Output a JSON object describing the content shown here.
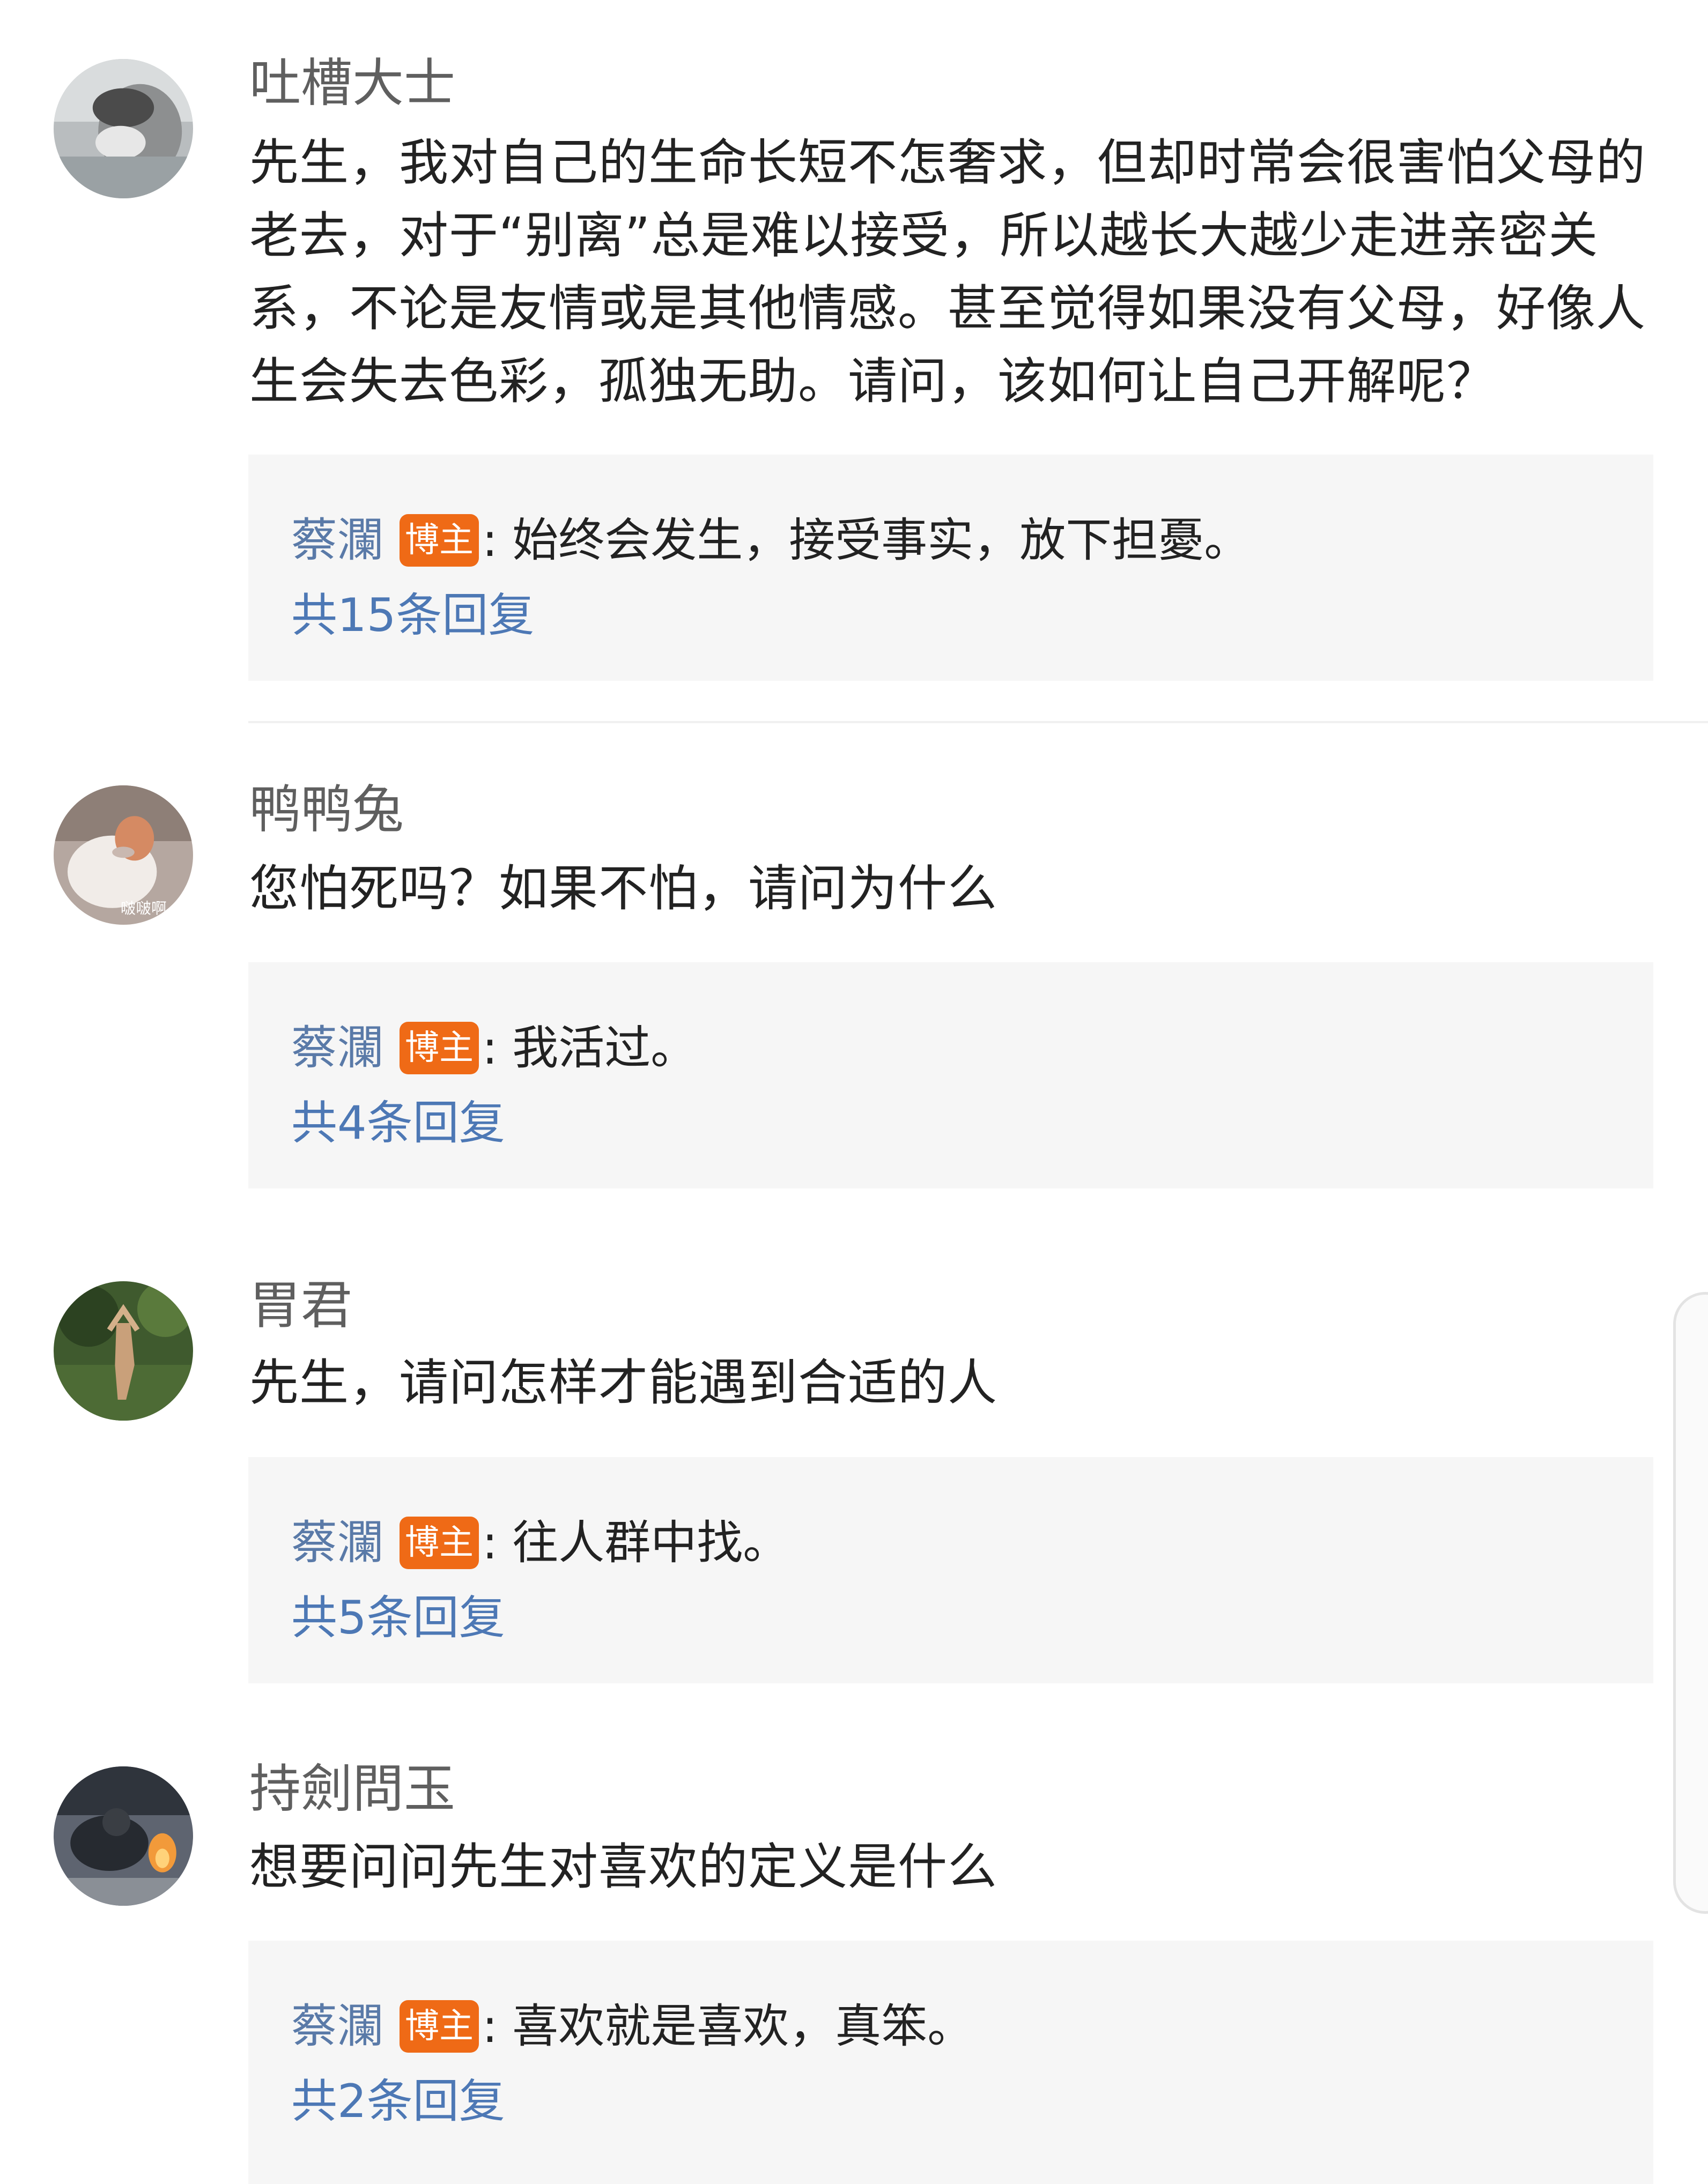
{
  "colors": {
    "username": "#5f5f5f",
    "text": "#222222",
    "reply_author": "#5a7aa8",
    "reply_count": "#4d78b5",
    "badge": "#ef6a16",
    "reply_bg": "#f6f6f6"
  },
  "comments": [
    {
      "username": "吐槽大士",
      "text": "先生，我对自己的生命长短不怎奢求，但却时常会很害怕父母的老去，对于“别离”总是难以接受，所以越长大越少走进亲密关系，不论是友情或是其他情感。甚至觉得如果没有父母，好像人生会失去色彩，孤独无助。请问，该如何让自己开解呢？",
      "reply": {
        "author": "蔡瀾",
        "badge": "博主",
        "text": ": 始终会发生，接受事实，放下担憂。",
        "count": "共15条回复"
      }
    },
    {
      "username": "鸭鸭兔",
      "text": "您怕死吗？如果不怕，请问为什么",
      "avatar_caption": "啵啵啊",
      "reply": {
        "author": "蔡瀾",
        "badge": "博主",
        "text": ": 我活过。",
        "count": "共4条回复"
      }
    },
    {
      "username": "胃君",
      "text": "先生，请问怎样才能遇到合适的人",
      "reply": {
        "author": "蔡瀾",
        "badge": "博主",
        "text": ": 往人群中找。",
        "count": "共5条回复"
      }
    },
    {
      "username": "持劍問玉",
      "text": "想要问问先生对喜欢的定义是什么",
      "reply": {
        "author": "蔡瀾",
        "badge": "博主",
        "text": ": 喜欢就是喜欢，真笨。",
        "count": "共2条回复"
      }
    }
  ]
}
